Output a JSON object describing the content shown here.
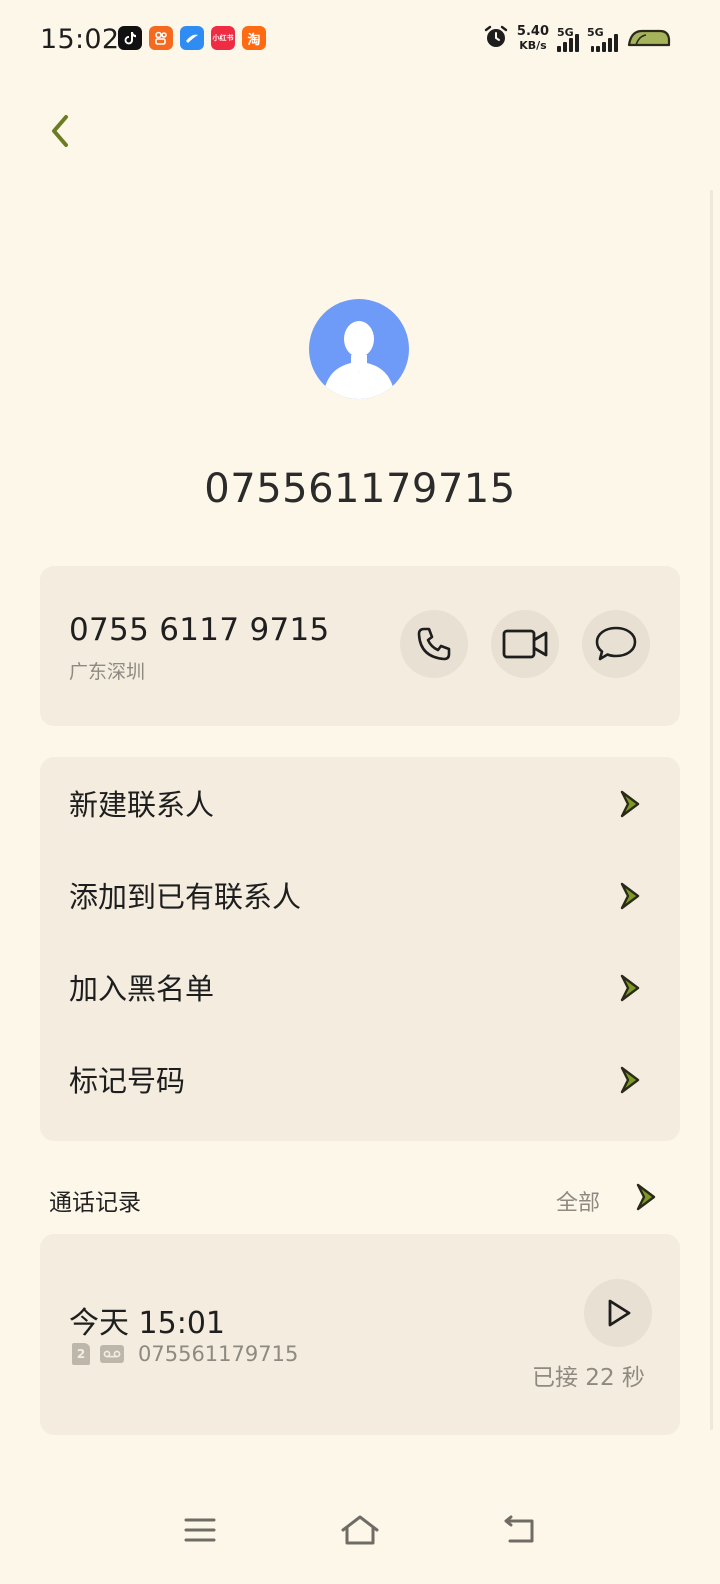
{
  "status_bar": {
    "time": "15:02",
    "app_icons": [
      {
        "name": "tiktok-app-icon",
        "glyph": "♪",
        "color": "#111111"
      },
      {
        "name": "kuaishou-app-icon",
        "glyph": "ஃ",
        "color": "#f56a1e"
      },
      {
        "name": "browser-app-icon",
        "glyph": "◢",
        "color": "#2f8cf3"
      },
      {
        "name": "xiaohongshu-app-icon",
        "glyph": "小红书",
        "color": "#f02b44"
      },
      {
        "name": "taobao-app-icon",
        "glyph": "淘",
        "color": "#ff6b12"
      }
    ],
    "net_speed_value": "5.40",
    "net_speed_unit": "KB/s",
    "signal_1_label": "5G",
    "signal_2_label": "5G"
  },
  "contact": {
    "title": "075561179715",
    "number_formatted": "0755 6117 9715",
    "location": "广东深圳"
  },
  "menu": {
    "items": [
      {
        "label": "新建联系人"
      },
      {
        "label": "添加到已有联系人"
      },
      {
        "label": "加入黑名单"
      },
      {
        "label": "标记号码"
      }
    ]
  },
  "history": {
    "title": "通话记录",
    "all_label": "全部",
    "entries": [
      {
        "time": "今天 15:01",
        "sim": "2",
        "number": "075561179715",
        "status": "已接 22 秒"
      }
    ]
  },
  "colors": {
    "background": "#fdf7e9",
    "card": "#f3ecdf",
    "accent": "#6b7d22",
    "avatar": "#6e9bf8",
    "secondary_text": "#8e8a82"
  }
}
